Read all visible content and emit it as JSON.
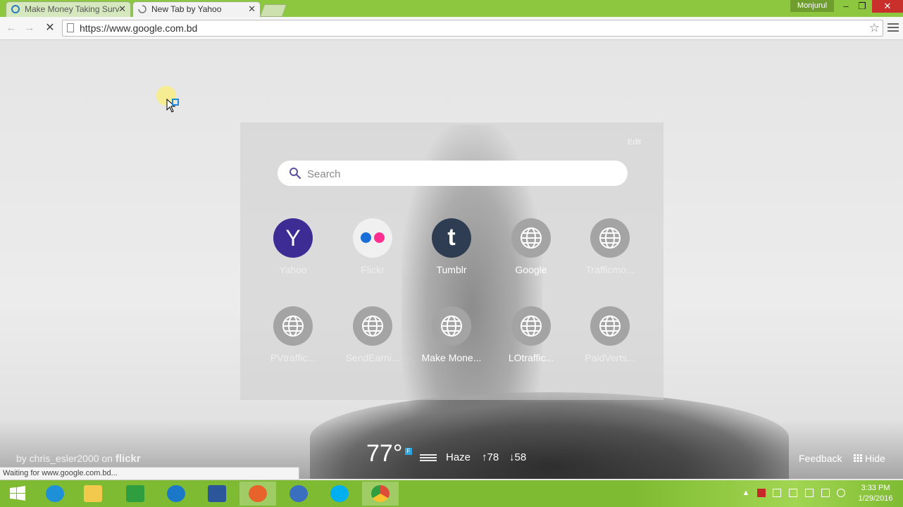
{
  "browser": {
    "tabs": [
      {
        "title": "Make Money Taking Surve",
        "active": false
      },
      {
        "title": "New Tab by Yahoo",
        "active": true
      }
    ],
    "user_name": "Monjurul",
    "window_controls": {
      "minimize": "–",
      "restore": "❐",
      "close": "✕"
    },
    "nav": {
      "back": "←",
      "forward": "→",
      "stop": "✕"
    },
    "url": "https://www.google.com.bd",
    "star": "☆"
  },
  "newtab": {
    "edit_label": "Edit",
    "search_placeholder": "Search",
    "tiles": [
      {
        "label": "Yahoo",
        "icon": "yahoo-logo",
        "glyph": "Y",
        "color": "#3d2c94"
      },
      {
        "label": "Flickr",
        "icon": "flickr-logo",
        "color": "#f2f2f2"
      },
      {
        "label": "Tumblr",
        "icon": "tumblr-logo",
        "glyph": "t",
        "color": "#2e3d52"
      },
      {
        "label": "Google",
        "icon": "globe-icon"
      },
      {
        "label": "Trafficmo...",
        "icon": "globe-icon"
      },
      {
        "label": "PVtraffic...",
        "icon": "globe-icon"
      },
      {
        "label": "SendEarni...",
        "icon": "globe-icon"
      },
      {
        "label": "Make Mone...",
        "icon": "globe-icon"
      },
      {
        "label": "LOtraffic...",
        "icon": "globe-icon"
      },
      {
        "label": "PaidVerts...",
        "icon": "globe-icon"
      }
    ],
    "credit_prefix": "by chris_esler2000 on",
    "credit_brand": "flickr",
    "weather": {
      "temp": "77°",
      "unit": "F",
      "condition": "Haze",
      "high": "↑78",
      "low": "↓58"
    },
    "feedback_label": "Feedback",
    "hide_label": "Hide",
    "hide_icon": "grid-icon"
  },
  "status_text": "Waiting for www.google.com.bd...",
  "taskbar": {
    "items": [
      {
        "name": "start-button",
        "color": "#ffffff"
      },
      {
        "name": "internet-explorer",
        "color": "#1e90d8"
      },
      {
        "name": "file-explorer",
        "color": "#f2c94c"
      },
      {
        "name": "windows-store",
        "color": "#2e9e3e"
      },
      {
        "name": "hp-support",
        "color": "#1b78c8"
      },
      {
        "name": "microsoft-word",
        "color": "#2b579a"
      },
      {
        "name": "firefox",
        "color": "#e8632b"
      },
      {
        "name": "unknown-app",
        "color": "#3a6fbf"
      },
      {
        "name": "skype",
        "color": "#00aff0"
      },
      {
        "name": "chrome",
        "color": "#dd4b39"
      }
    ],
    "time": "3:33 PM",
    "date": "1/29/2016"
  }
}
